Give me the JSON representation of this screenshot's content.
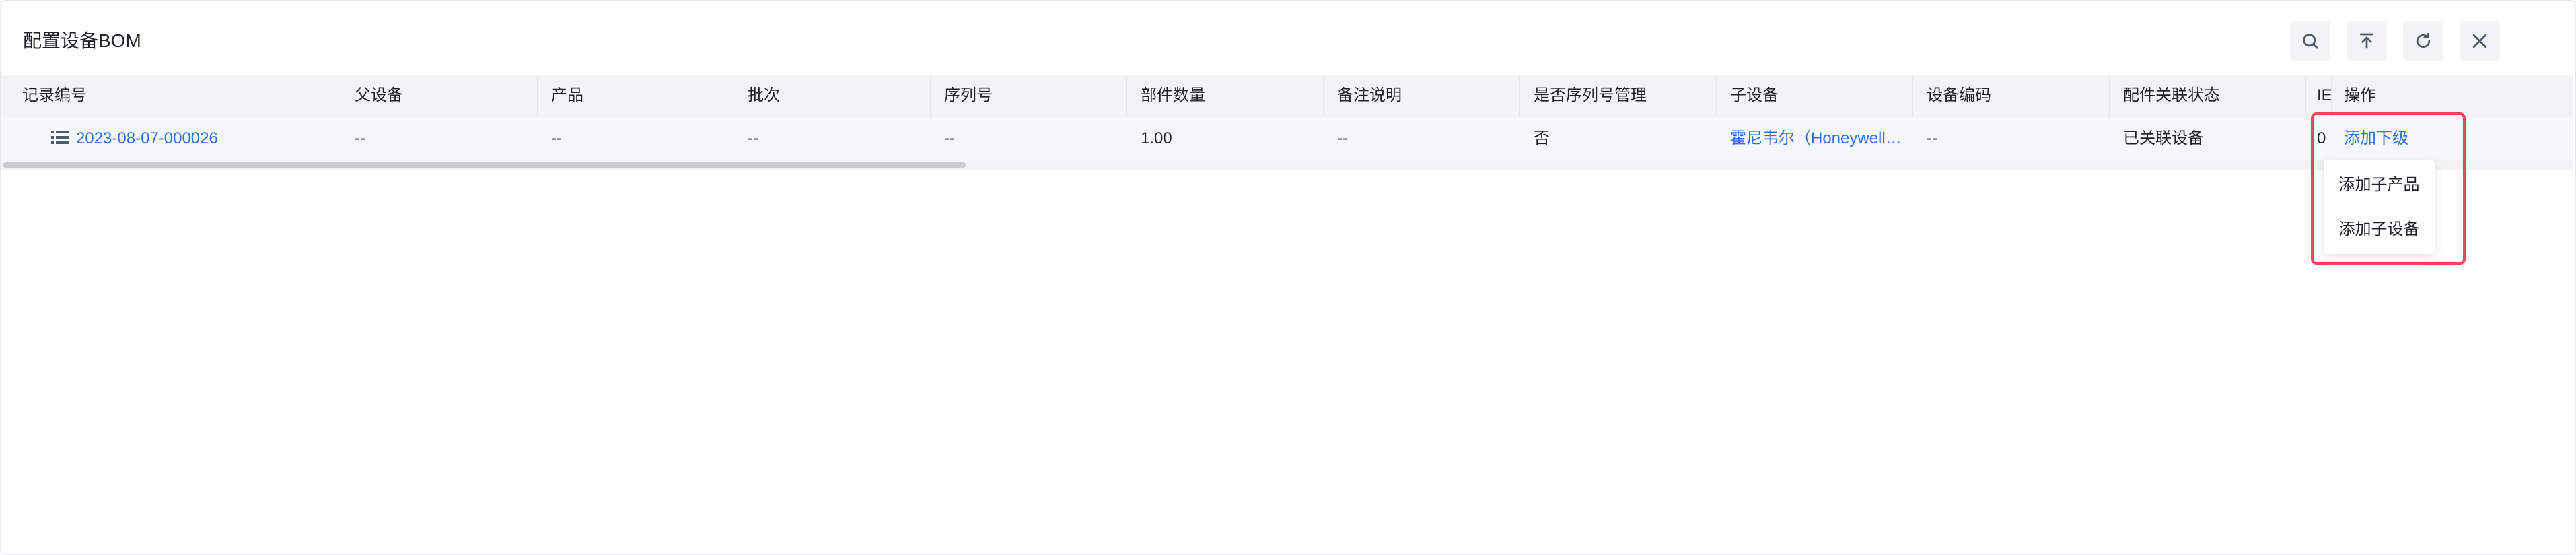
{
  "title": "配置设备BOM",
  "toolbar": [
    {
      "name": "search-icon",
      "label": "search"
    },
    {
      "name": "upload-icon",
      "label": "to-top"
    },
    {
      "name": "refresh-icon",
      "label": "refresh"
    },
    {
      "name": "close-icon",
      "label": "close"
    }
  ],
  "table": {
    "columns": [
      "记录编号",
      "父设备",
      "产品",
      "批次",
      "序列号",
      "部件数量",
      "备注说明",
      "是否序列号管理",
      "子设备",
      "设备编码",
      "配件关联状态",
      "IE",
      "操作"
    ],
    "row": {
      "record_no": "2023-08-07-000026",
      "parent": "--",
      "product": "--",
      "batch": "--",
      "serial": "--",
      "quantity": "1.00",
      "remark": "--",
      "serial_managed": "否",
      "child_device": "霍尼韦尔（Honeywell…",
      "device_code": "--",
      "link_status": "已关联设备",
      "ie": "0",
      "action": "添加下级"
    }
  },
  "dropdown": {
    "items": [
      "添加子产品",
      "添加子设备"
    ]
  },
  "colors": {
    "link": "#2f6fe0",
    "highlight": "#f0455a",
    "header_bg": "#f2f3f5"
  }
}
